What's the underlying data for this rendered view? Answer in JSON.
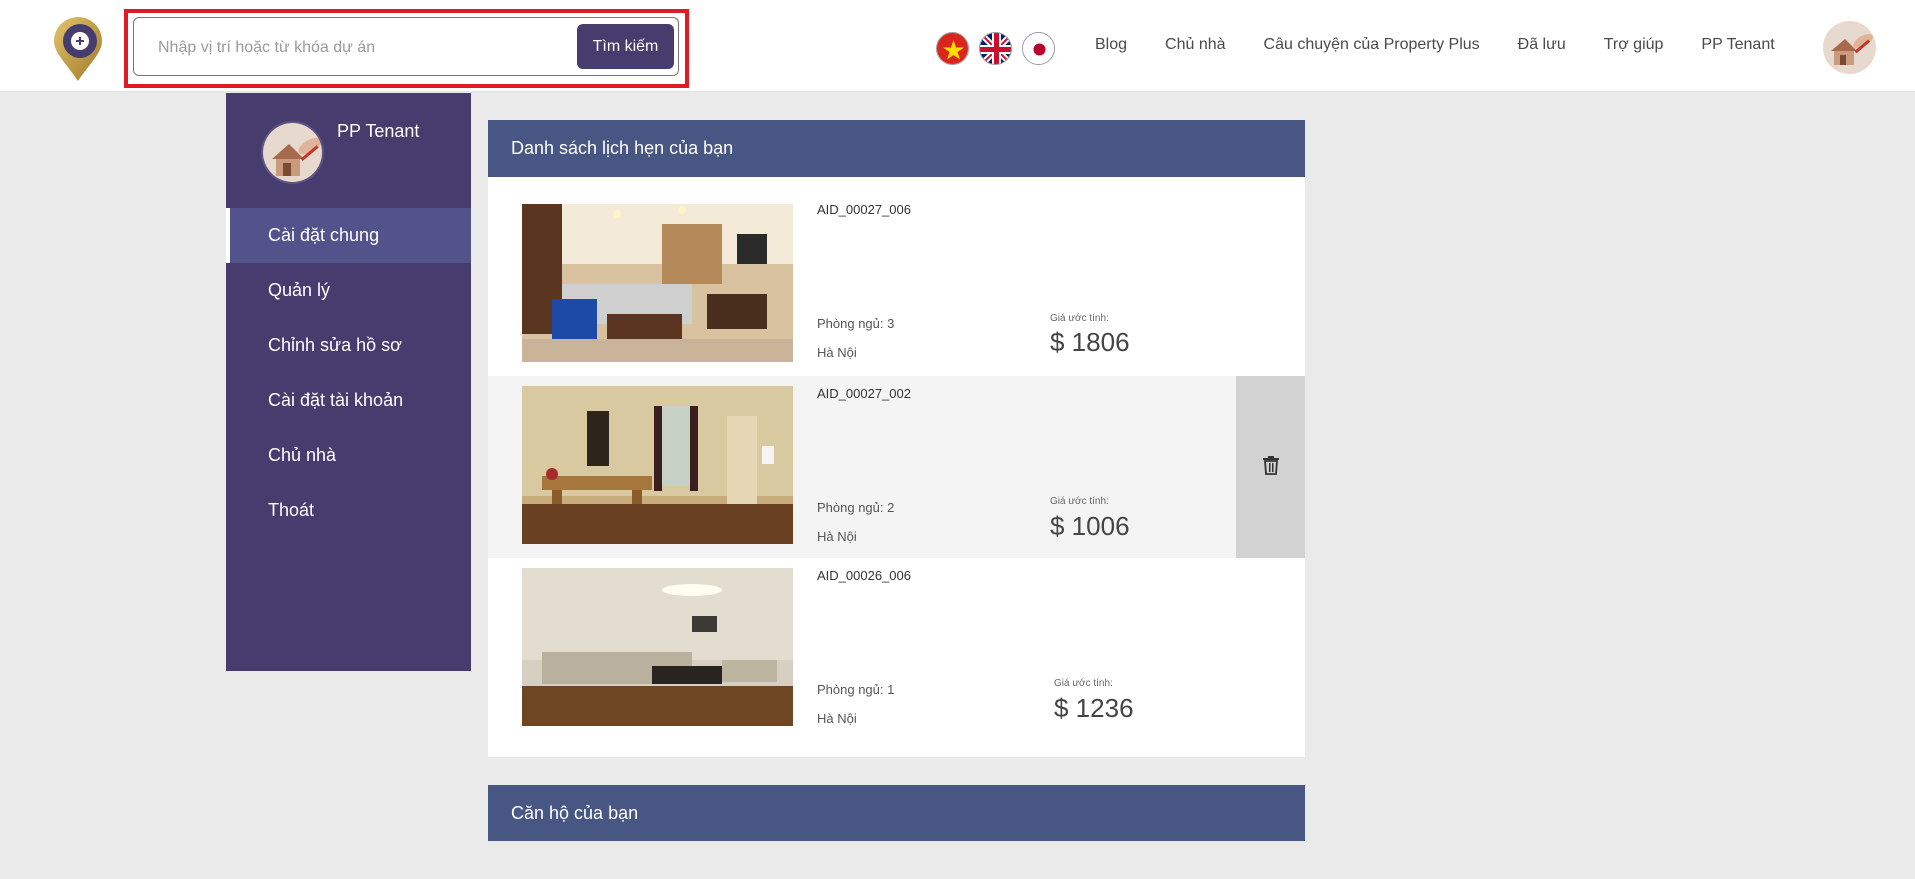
{
  "header": {
    "search": {
      "placeholder": "Nhập vị trí hoặc từ khóa dự án",
      "value": "",
      "button_label": "Tìm kiếm"
    },
    "languages": [
      {
        "name": "vietnam-flag-icon"
      },
      {
        "name": "uk-flag-icon"
      },
      {
        "name": "japan-flag-icon"
      }
    ],
    "nav": [
      "Blog",
      "Chủ nhà",
      "Câu chuyện của Property Plus",
      "Đã lưu",
      "Trợ giúp",
      "PP Tenant"
    ]
  },
  "sidebar": {
    "user_name": "PP Tenant",
    "items": [
      {
        "label": "Cài đặt chung",
        "active": true
      },
      {
        "label": "Quản lý",
        "active": false
      },
      {
        "label": "Chỉnh sửa hồ sơ",
        "active": false
      },
      {
        "label": "Cài đặt tài khoản",
        "active": false
      },
      {
        "label": "Chủ nhà",
        "active": false
      },
      {
        "label": "Thoát",
        "active": false
      }
    ]
  },
  "appointments": {
    "title": "Danh sách lịch hẹn của bạn",
    "items": [
      {
        "id": "AID_00027_006",
        "rooms": "Phòng ngủ: 3",
        "city": "Hà Nội",
        "price_label": "Giá ước tính:",
        "price": "$ 1806"
      },
      {
        "id": "AID_00027_002",
        "rooms": "Phòng ngủ: 2",
        "city": "Hà Nội",
        "price_label": "Giá ước tính:",
        "price": "$ 1006"
      },
      {
        "id": "AID_00026_006",
        "rooms": "Phòng ngủ: 1",
        "city": "Hà Nội",
        "price_label": "Giá ước tính:",
        "price": "$ 1236"
      }
    ]
  },
  "apartments": {
    "title": "Căn hộ của bạn"
  },
  "colors": {
    "brand": "#463c6e",
    "panel_header": "#475683",
    "highlight": "#e01b24"
  }
}
